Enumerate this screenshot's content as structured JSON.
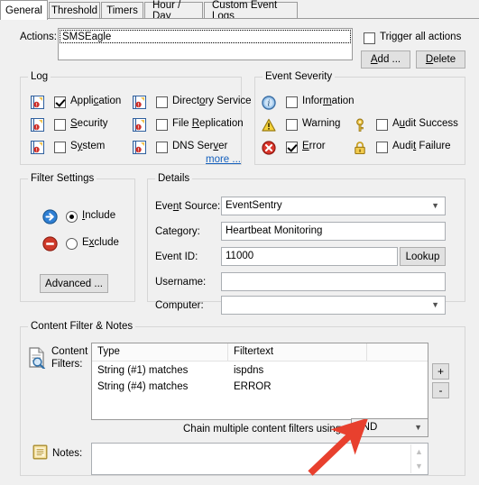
{
  "window": {
    "tabs": [
      {
        "label": "General",
        "active": true
      },
      {
        "label": "Threshold",
        "active": false
      },
      {
        "label": "Timers",
        "active": false
      },
      {
        "label": "Hour / Day",
        "active": false
      },
      {
        "label": "Custom Event Logs",
        "active": false
      }
    ]
  },
  "actions": {
    "label": "Actions:",
    "items": [
      "SMSEagle"
    ],
    "trigger_all_label": "Trigger all actions",
    "trigger_all_checked": false,
    "add_label": "Add ...",
    "delete_label": "Delete"
  },
  "log": {
    "title": "Log",
    "more_label": "more ...",
    "items": [
      {
        "label": "Application",
        "checked": true,
        "icon": "event-log-icon"
      },
      {
        "label": "Security",
        "checked": false,
        "icon": "event-log-icon"
      },
      {
        "label": "System",
        "checked": false,
        "icon": "event-log-icon"
      },
      {
        "label": "Directory Service",
        "checked": false,
        "icon": "event-log-icon"
      },
      {
        "label": "File Replication",
        "checked": false,
        "icon": "event-log-icon"
      },
      {
        "label": "DNS Server",
        "checked": false,
        "icon": "event-log-icon"
      }
    ]
  },
  "severity": {
    "title": "Event Severity",
    "items": [
      {
        "label": "Information",
        "checked": false,
        "icon": "information-icon",
        "color": "#4a90d9"
      },
      {
        "label": "Warning",
        "checked": false,
        "icon": "warning-icon",
        "color": "#f5c518"
      },
      {
        "label": "Error",
        "checked": true,
        "icon": "error-icon",
        "color": "#d32424"
      },
      {
        "label": "Audit Success",
        "checked": false,
        "icon": "key-icon",
        "color": "#e8b33a"
      },
      {
        "label": "Audit Failure",
        "checked": false,
        "icon": "padlock-icon",
        "color": "#e8b33a"
      }
    ]
  },
  "filter_settings": {
    "title": "Filter Settings",
    "include_label": "Include",
    "exclude_label": "Exclude",
    "selected": "Include",
    "advanced_label": "Advanced ...",
    "include_icon": "blue-arrow-icon",
    "exclude_icon": "red-deny-icon"
  },
  "details": {
    "title": "Details",
    "event_source_label": "Event Source:",
    "event_source_value": "EventSentry",
    "category_label": "Category:",
    "category_value": "Heartbeat Monitoring",
    "event_id_label": "Event ID:",
    "event_id_value": "11000",
    "lookup_label": "Lookup",
    "username_label": "Username:",
    "username_value": "",
    "computer_label": "Computer:",
    "computer_value": ""
  },
  "content_filter": {
    "title": "Content Filter & Notes",
    "content_filters_label_line1": "Content",
    "content_filters_label_line2": "Filters:",
    "content_filters_icon": "document-search-icon",
    "columns": [
      "Type",
      "Filtertext"
    ],
    "rows": [
      {
        "type": "String (#1) matches",
        "filtertext": "ispdns"
      },
      {
        "type": "String (#4) matches",
        "filtertext": "ERROR"
      }
    ],
    "add_button_label": "+",
    "remove_button_label": "-",
    "chain_label": "Chain multiple content filters using a",
    "chain_value": "AND",
    "notes_label": "Notes:",
    "notes_value": "",
    "notes_icon": "notepad-icon"
  },
  "annotation": {
    "arrow_color": "#e8402e",
    "points_to": "AND"
  }
}
